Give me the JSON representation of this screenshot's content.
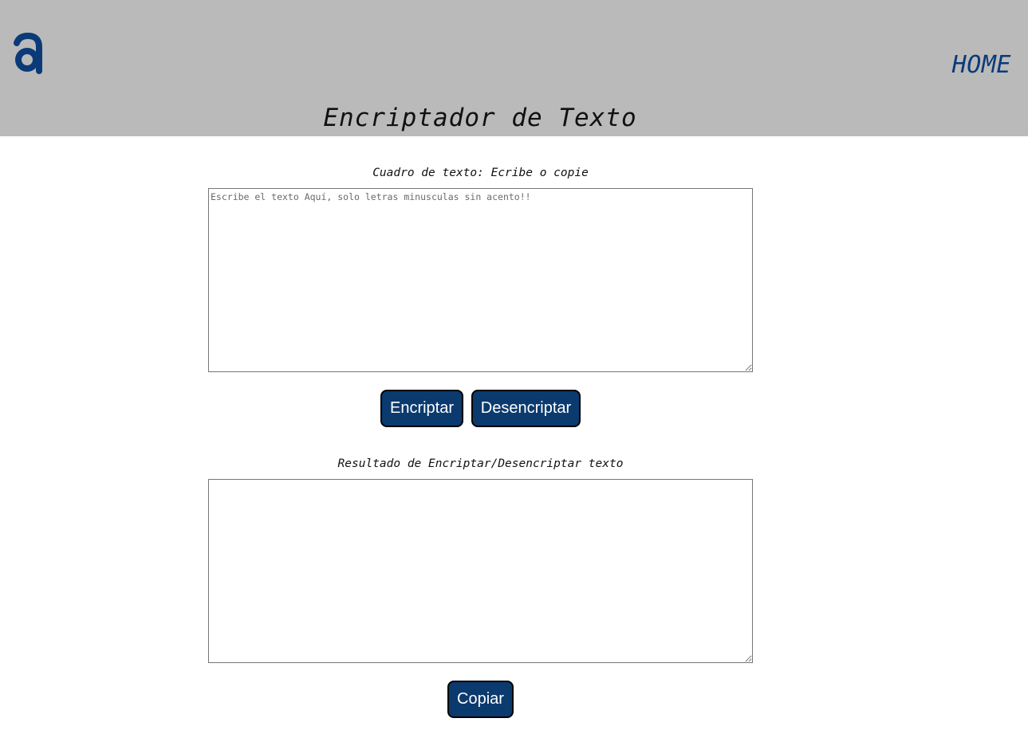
{
  "header": {
    "logo_icon": "letter-a-logo-icon",
    "logo_color": "#0b3a78",
    "home_link": "HOME",
    "background": "#bababa"
  },
  "main": {
    "title": "Encriptador de Texto",
    "input_label": "Cuadro de texto: Ecribe o copie",
    "input_placeholder": "Escribe el texto Aquí, solo letras minusculas sin acento!!",
    "input_value": "",
    "encrypt_button": "Encriptar",
    "decrypt_button": "Desencriptar",
    "output_label": "Resultado de Encriptar/Desencriptar texto",
    "output_value": "",
    "copy_button": "Copiar",
    "button_color": "#0b3a6e"
  }
}
